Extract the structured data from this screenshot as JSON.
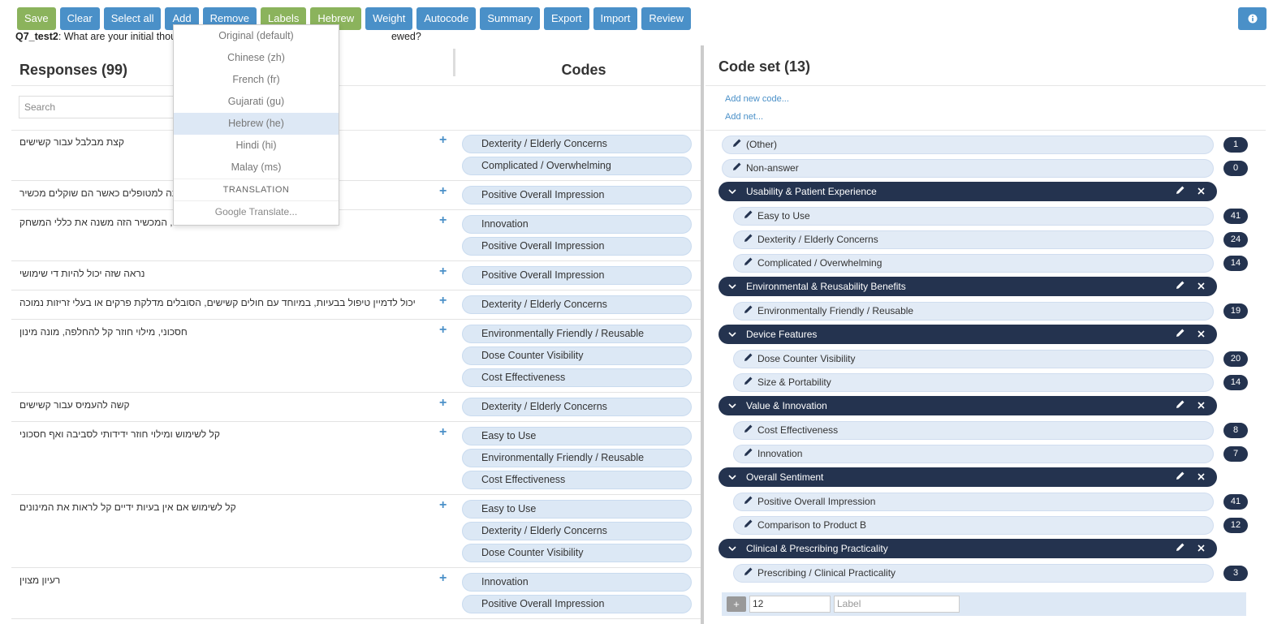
{
  "toolbar": {
    "buttons": [
      "Save",
      "Clear",
      "Select all",
      "Add",
      "Remove",
      "Labels",
      "Hebrew",
      "Weight",
      "Autocode",
      "Summary",
      "Export",
      "Import",
      "Review"
    ],
    "info_icon": "info-icon"
  },
  "question": {
    "id": "Q7_test2",
    "text_start": ": What are your initial thoug",
    "text_end": "ewed?"
  },
  "responses": {
    "title": "Responses (99)",
    "search_placeholder": "Search",
    "rows": [
      {
        "text": "קצת מבלבל עבור קשישים",
        "codes": [
          "Dexterity / Elderly Concerns",
          "Complicated / Overwhelming"
        ]
      },
      {
        "text": "טובה למטופלים כאשר הם שוקלים מכשיר",
        "codes": [
          "Positive Overall Impression"
        ]
      },
      {
        "text": "הים, המכשיר הזה משנה את כללי המשחק",
        "codes": [
          "Innovation",
          "Positive Overall Impression"
        ]
      },
      {
        "text": "נראה שזה יכול להיות די שימושי",
        "codes": [
          "Positive Overall Impression"
        ]
      },
      {
        "text": "יכול לדמיין טיפול בבעיות, במיוחד עם חולים קשישים, הסובלים מדלקת פרקים או בעלי זריזות נמוכה",
        "codes": [
          "Dexterity / Elderly Concerns"
        ]
      },
      {
        "text": "חסכוני, מילוי חוזר קל להחלפה, מונה מינון",
        "codes": [
          "Environmentally Friendly / Reusable",
          "Dose Counter Visibility",
          "Cost Effectiveness"
        ]
      },
      {
        "text": "קשה להעמיס עבור קשישים",
        "codes": [
          "Dexterity / Elderly Concerns"
        ]
      },
      {
        "text": "קל לשימוש ומילוי חוזר ידידותי לסביבה ואף חסכוני",
        "codes": [
          "Easy to Use",
          "Environmentally Friendly / Reusable",
          "Cost Effectiveness"
        ]
      },
      {
        "text": "קל לשימוש אם אין בעיות ידיים קל לראות את המינונים",
        "codes": [
          "Easy to Use",
          "Dexterity / Elderly Concerns",
          "Dose Counter Visibility"
        ]
      },
      {
        "text": "רעיון מצוין",
        "codes": [
          "Innovation",
          "Positive Overall Impression"
        ]
      }
    ]
  },
  "codes_title": "Codes",
  "language_menu": {
    "items": [
      "Original (default)",
      "Chinese (zh)",
      "French (fr)",
      "Gujarati (gu)",
      "Hebrew (he)",
      "Hindi (hi)",
      "Malay (ms)"
    ],
    "selected": "Hebrew (he)",
    "section_header": "TRANSLATION",
    "google": "Google Translate..."
  },
  "codeset": {
    "title": "Code set (13)",
    "add_code": "Add new code...",
    "add_net": "Add net...",
    "entries": [
      {
        "kind": "code",
        "label": "(Other)",
        "count": "1",
        "indent": false
      },
      {
        "kind": "code",
        "label": "Non-answer",
        "count": "0",
        "indent": false
      },
      {
        "kind": "net",
        "label": "Usability & Patient Experience"
      },
      {
        "kind": "code",
        "label": "Easy to Use",
        "count": "41",
        "indent": true
      },
      {
        "kind": "code",
        "label": "Dexterity / Elderly Concerns",
        "count": "24",
        "indent": true
      },
      {
        "kind": "code",
        "label": "Complicated / Overwhelming",
        "count": "14",
        "indent": true
      },
      {
        "kind": "net",
        "label": "Environmental & Reusability Benefits"
      },
      {
        "kind": "code",
        "label": "Environmentally Friendly / Reusable",
        "count": "19",
        "indent": true
      },
      {
        "kind": "net",
        "label": "Device Features"
      },
      {
        "kind": "code",
        "label": "Dose Counter Visibility",
        "count": "20",
        "indent": true
      },
      {
        "kind": "code",
        "label": "Size & Portability",
        "count": "14",
        "indent": true
      },
      {
        "kind": "net",
        "label": "Value & Innovation"
      },
      {
        "kind": "code",
        "label": "Cost Effectiveness",
        "count": "8",
        "indent": true
      },
      {
        "kind": "code",
        "label": "Innovation",
        "count": "7",
        "indent": true
      },
      {
        "kind": "net",
        "label": "Overall Sentiment"
      },
      {
        "kind": "code",
        "label": "Positive Overall Impression",
        "count": "41",
        "indent": true
      },
      {
        "kind": "code",
        "label": "Comparison to Product B",
        "count": "12",
        "indent": true
      },
      {
        "kind": "net",
        "label": "Clinical & Prescribing Practicality"
      },
      {
        "kind": "code",
        "label": "Prescribing / Clinical Practicality",
        "count": "3",
        "indent": true
      }
    ],
    "new_code": {
      "number": "12",
      "label_placeholder": "Label",
      "add_symbol": "+"
    }
  },
  "colors": {
    "button": "#4a90c8",
    "button_green": "#8bb35c",
    "net": "#24334f",
    "pill": "#dce8f5"
  }
}
